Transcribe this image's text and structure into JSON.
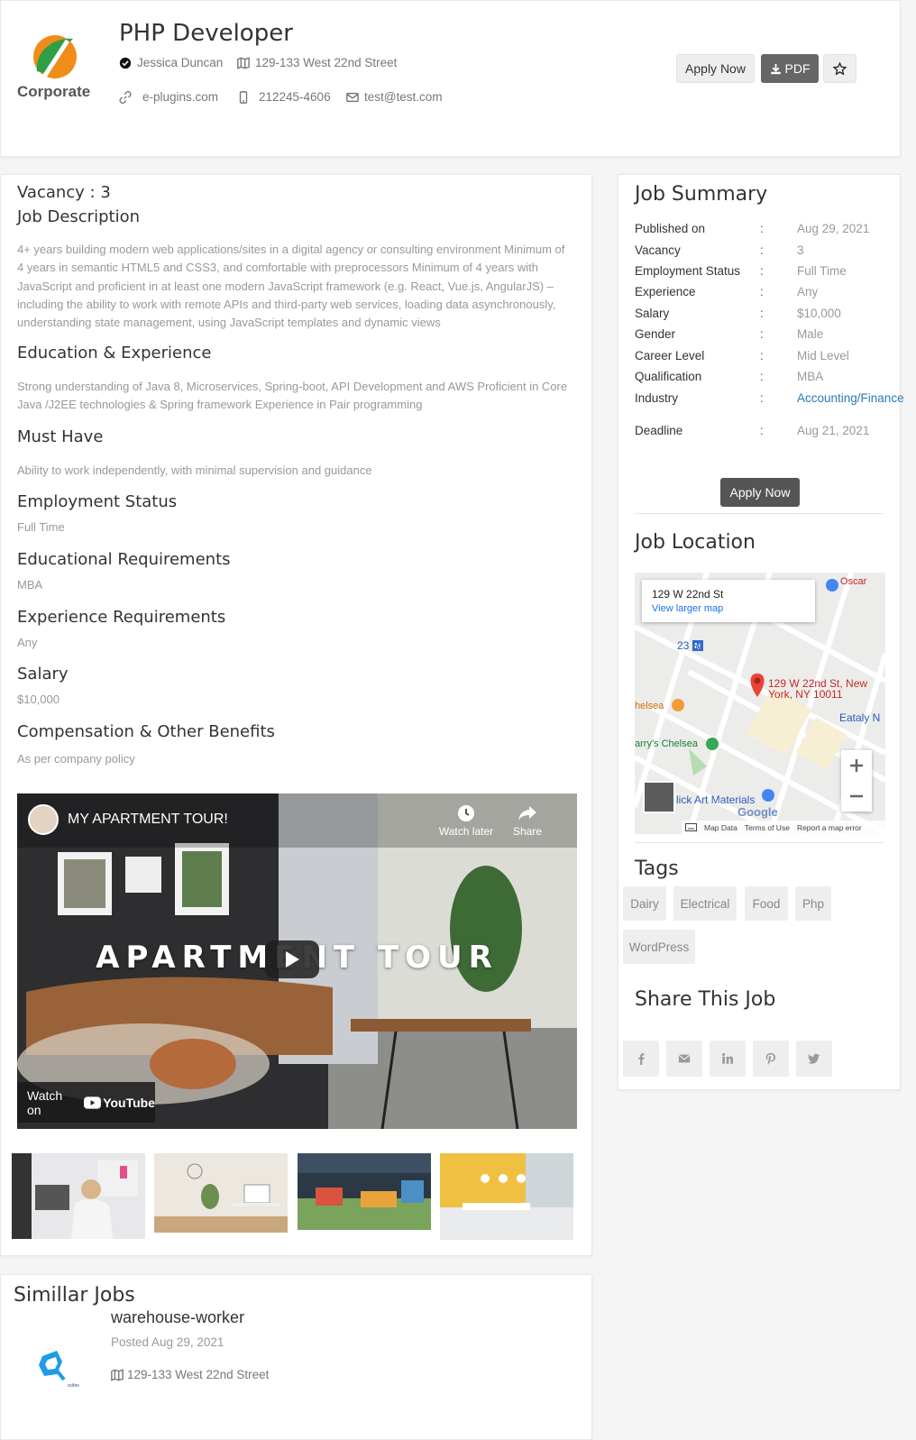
{
  "header": {
    "logo_text": "Corporate",
    "title": "PHP Developer",
    "author": "Jessica Duncan",
    "address": "129-133 West 22nd Street",
    "website": "e-plugins.com",
    "phone": "212245-4606",
    "email": "test@test.com",
    "apply_label": "Apply Now",
    "pdf_label": "PDF"
  },
  "main": {
    "vacancy": "Vacancy : 3",
    "job_desc_h": "Job Description",
    "job_desc": "4+ years building modern web applications/sites in a digital agency or consulting environment Minimum of 4 years in semantic HTML5 and CSS3, and comfortable with preprocessors Minimum of 4 years with JavaScript and proficient in at least one modern JavaScript framework (e.g. React, Vue.js, AngularJS) – including the ability to work with remote APIs and third-party web services, loading data asynchronously, understanding state management, using JavaScript templates and dynamic views",
    "edu_exp_h": "Education & Experience",
    "edu_exp": "Strong understanding of Java 8, Microservices, Spring-boot, API Development and AWS Proficient in Core Java /J2EE technologies & Spring framework Experience in Pair programming",
    "must_have_h": "Must Have",
    "must_have": "Ability to work independently, with minimal supervision and guidance",
    "emp_status_h": "Employment Status",
    "emp_status": "Full Time",
    "edu_req_h": "Educational Requirements",
    "edu_req": "MBA",
    "exp_req_h": "Experience Requirements",
    "exp_req": "Any",
    "salary_h": "Salary",
    "salary": "$10,000",
    "benefits_h": "Compensation & Other Benefits",
    "benefits": "As per company policy",
    "video": {
      "title": "MY APARTMENT TOUR!",
      "overlay": "APARTMENT TOUR",
      "watch_later": "Watch later",
      "share": "Share",
      "watch_on": "Watch on",
      "youtube": "YouTube"
    }
  },
  "summary": {
    "title": "Job Summary",
    "rows": [
      {
        "k": "Published on",
        "v": "Aug 29, 2021"
      },
      {
        "k": "Vacancy",
        "v": "3"
      },
      {
        "k": "Employment Status",
        "v": "Full Time"
      },
      {
        "k": "Experience",
        "v": "Any"
      },
      {
        "k": "Salary",
        "v": "$10,000"
      },
      {
        "k": "Gender",
        "v": "Male"
      },
      {
        "k": "Career Level",
        "v": "Mid Level"
      },
      {
        "k": "Qualification",
        "v": "MBA"
      },
      {
        "k": "Industry",
        "v": "Accounting/Finance"
      }
    ],
    "deadline_k": "Deadline",
    "deadline_v": "Aug 21, 2021",
    "colon": ":",
    "apply_label": "Apply Now"
  },
  "location": {
    "title": "Job Location",
    "card_addr": "129 W 22nd St",
    "card_link": "View larger map",
    "pin_label_1": "129 W 22nd St, New",
    "pin_label_2": "York, NY 10011",
    "poi_oscar": "Oscar",
    "poi_chelsea": "helsea",
    "poi_eataly": "Eataly N",
    "poi_barrys": "arry's Chelsea",
    "poi_blick": "lick Art Materials",
    "street_23": "23 St",
    "footer_data": "Map Data",
    "footer_terms": "Terms of Use",
    "footer_report": "Report a map error",
    "google": "Google"
  },
  "tags": {
    "title": "Tags",
    "items": [
      "Dairy",
      "Electrical",
      "Food",
      "Php",
      "WordPress"
    ]
  },
  "share": {
    "title": "Share This Job"
  },
  "similar": {
    "title": "Simillar Jobs",
    "job_title": "warehouse-worker",
    "posted": "Posted Aug 29, 2021",
    "address": "129-133 West 22nd Street",
    "logo_caption": "scifex"
  },
  "colors": {
    "accent_link": "#2a7ab8",
    "dark_button": "#555555",
    "logo_green": "#2f9e44",
    "logo_orange": "#f08c1a"
  }
}
